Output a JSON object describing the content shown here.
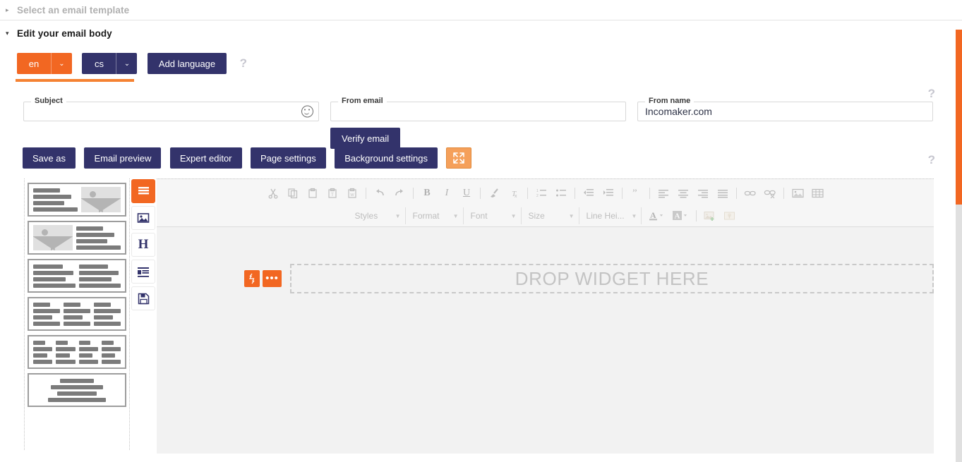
{
  "sections": {
    "collapsed": {
      "title": "Select an email template",
      "arrow": "▸"
    },
    "expanded": {
      "title": "Edit your email body",
      "arrow": "▾"
    }
  },
  "language_bar": {
    "languages": [
      {
        "code": "en",
        "active": true,
        "caret": "⌄"
      },
      {
        "code": "cs",
        "active": false,
        "caret": "⌄"
      }
    ],
    "add_language_label": "Add language",
    "help": "?",
    "active_color": "#f26722",
    "inactive_color": "#33336b"
  },
  "fields": {
    "subject": {
      "label": "Subject",
      "value": "",
      "placeholder": ""
    },
    "from_email": {
      "label": "From email",
      "value": "",
      "placeholder": ""
    },
    "from_name": {
      "label": "From name",
      "value": "Incomaker.com",
      "placeholder": ""
    },
    "verify_button": "Verify email",
    "help": "?"
  },
  "actions": {
    "buttons": [
      "Save as",
      "Email preview",
      "Expert editor",
      "Page settings",
      "Background settings"
    ],
    "fullscreen_icon": "fullscreen-icon",
    "help": "?"
  },
  "widget_templates": [
    {
      "name": "text-left-image-right",
      "layout": "text-image"
    },
    {
      "name": "image-left-text-right",
      "layout": "image-text"
    },
    {
      "name": "two-text-columns",
      "layout": "text-text"
    },
    {
      "name": "three-columns",
      "layout": "three-col"
    },
    {
      "name": "four-columns",
      "layout": "four-col"
    },
    {
      "name": "centered-text",
      "layout": "centered"
    }
  ],
  "tool_strip": [
    {
      "name": "rows-icon",
      "glyph": "☰",
      "active": true
    },
    {
      "name": "image-icon",
      "glyph": "image",
      "active": false
    },
    {
      "name": "heading-icon",
      "glyph": "H",
      "active": false
    },
    {
      "name": "text-block-icon",
      "glyph": "text",
      "active": false
    },
    {
      "name": "save-icon",
      "glyph": "save",
      "active": false
    }
  ],
  "editor_toolbar": {
    "row1": [
      {
        "name": "cut-icon"
      },
      {
        "name": "copy-icon"
      },
      {
        "name": "paste-icon"
      },
      {
        "name": "paste-as-text-icon"
      },
      {
        "name": "paste-from-word-icon"
      },
      {
        "sep": true
      },
      {
        "name": "undo-icon"
      },
      {
        "name": "redo-icon"
      },
      {
        "sep": true
      },
      {
        "name": "bold-icon",
        "label": "B"
      },
      {
        "name": "italic-icon",
        "label": "I"
      },
      {
        "name": "underline-icon",
        "label": "U"
      },
      {
        "sep": true
      },
      {
        "name": "remove-format-icon"
      },
      {
        "name": "clear-text-format-icon"
      },
      {
        "sep": true
      },
      {
        "name": "numbered-list-icon"
      },
      {
        "name": "bulleted-list-icon"
      },
      {
        "sep": true
      },
      {
        "name": "outdent-icon"
      },
      {
        "name": "indent-icon"
      },
      {
        "sep": true
      },
      {
        "name": "blockquote-icon"
      },
      {
        "sep": true
      },
      {
        "name": "align-left-icon"
      },
      {
        "name": "align-center-icon"
      },
      {
        "name": "align-right-icon"
      },
      {
        "name": "align-justify-icon"
      },
      {
        "sep": true
      },
      {
        "name": "link-icon"
      },
      {
        "name": "unlink-icon"
      },
      {
        "sep": true
      },
      {
        "name": "insert-image-icon"
      },
      {
        "name": "insert-table-icon"
      }
    ],
    "combos": [
      {
        "name": "styles-dropdown",
        "label": "Styles"
      },
      {
        "name": "format-dropdown",
        "label": "Format"
      },
      {
        "name": "font-dropdown",
        "label": "Font"
      },
      {
        "name": "size-dropdown",
        "label": "Size"
      },
      {
        "name": "line-height-dropdown",
        "label": "Line Hei..."
      }
    ],
    "row2_icons": [
      {
        "name": "text-color-icon",
        "label": "A"
      },
      {
        "name": "background-color-icon",
        "label": "A"
      },
      {
        "name": "add-image-icon"
      },
      {
        "name": "image-map-icon"
      }
    ]
  },
  "dropzone": {
    "text": "DROP WIDGET HERE",
    "move_handle": "↕",
    "more_options": "•••"
  },
  "scrollbar": {
    "thumb_color": "#f26722",
    "track_color": "#e0e0e0"
  }
}
